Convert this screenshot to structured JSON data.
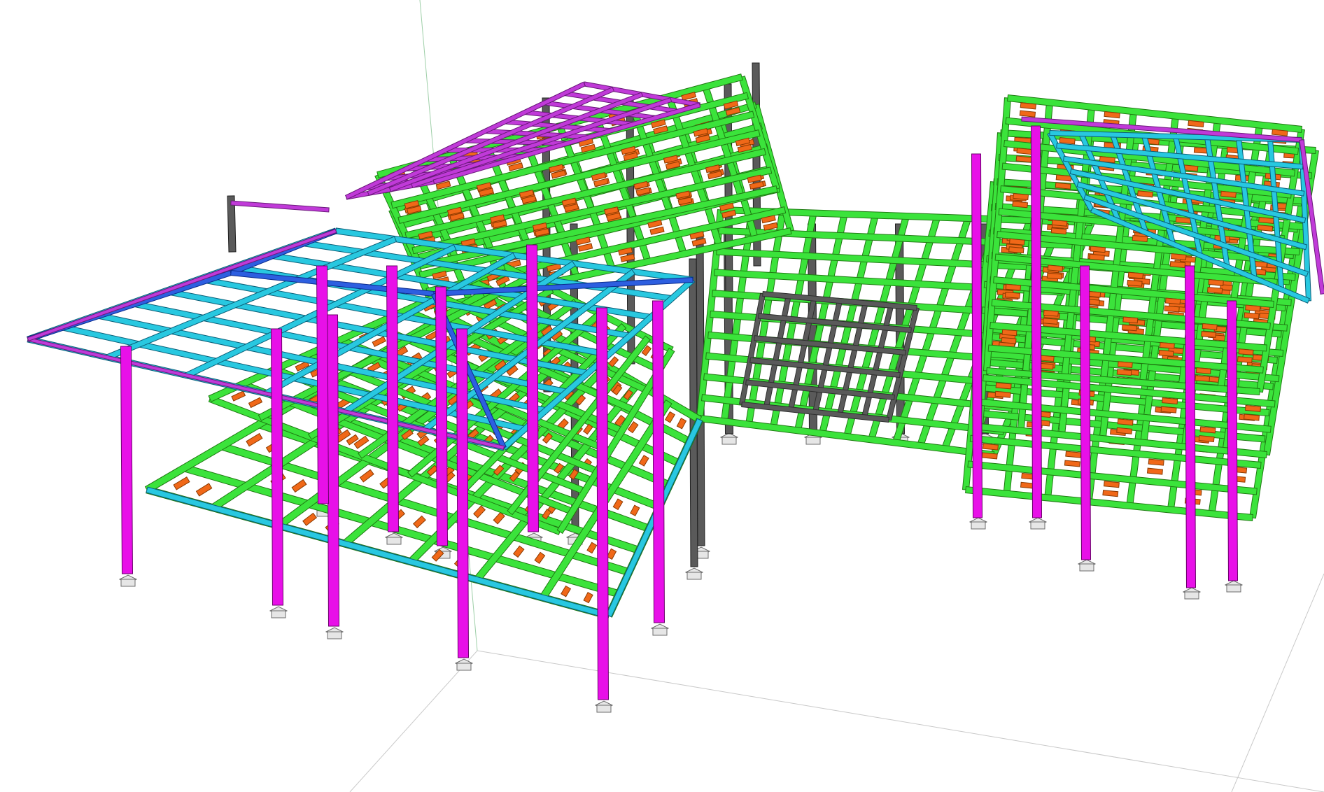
{
  "viewer": {
    "view_mode": "3d-structural-model",
    "background_color": "#ffffff"
  },
  "colors": {
    "floor_beam": "#3be33b",
    "roof_beam": "#28c8e0",
    "rafter": "#2d5fe0",
    "roof_edge": "#c03ad8",
    "column": "#e810e8",
    "grey_member": "#5a5a5a",
    "secondary_beam": "#f06818",
    "axis": "#9ecfa8"
  },
  "model": {
    "left_wing": {
      "floor_levels": 2,
      "roof": "hip-roof-framing"
    },
    "central_block": {
      "floor_levels": 1,
      "roof": "flat-grid"
    },
    "right_wing": {
      "floor_levels": 3,
      "roof": "sloped-roof-framing"
    },
    "footing_type": "pad-footing"
  }
}
